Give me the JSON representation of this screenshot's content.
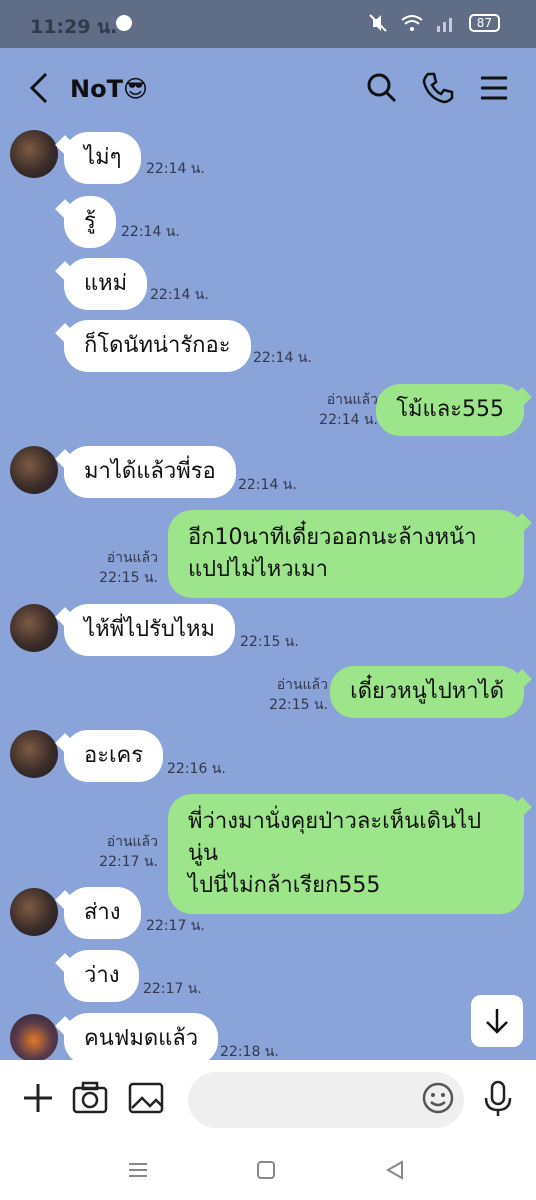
{
  "status": {
    "time": "11:29 น.",
    "battery": "87"
  },
  "header": {
    "title": "NoT😎"
  },
  "messages": [
    {
      "dir": "in",
      "text": "ไม่ๆ",
      "time": "22:14 น."
    },
    {
      "dir": "in",
      "text": "รู้",
      "time": "22:14 น."
    },
    {
      "dir": "in",
      "text": "แหม่",
      "time": "22:14 น."
    },
    {
      "dir": "in",
      "text": "ก็โดนัทน่ารักอะ",
      "time": "22:14 น."
    },
    {
      "dir": "out",
      "text": "โม้และ555",
      "read": "อ่านแล้ว",
      "time": "22:14 น."
    },
    {
      "dir": "in",
      "text": "มาได้แล้วพี่รอ",
      "time": "22:14 น."
    },
    {
      "dir": "out",
      "text": "อีก10นาทีเดี๋ยวออกนะล้างหน้าแปปไม่ไหวเมา",
      "line1": "อีก10นาทีเดี๋ยวออกนะล้างหน้า",
      "line2": "แปปไม่ไหวเมา",
      "read": "อ่านแล้ว",
      "time": "22:15 น."
    },
    {
      "dir": "in",
      "text": "ไห้พี่ไปรับไหม",
      "time": "22:15 น."
    },
    {
      "dir": "out",
      "text": "เดี๋ยวหนูไปหาได้",
      "read": "อ่านแล้ว",
      "time": "22:15 น."
    },
    {
      "dir": "in",
      "text": "อะเคร",
      "time": "22:16 น."
    },
    {
      "dir": "out",
      "text": "พี่ว่างมานั่งคุยป่าวละเห็นเดินไปนู่นไปนี่ไม่กล้าเรียก555",
      "line1": "พี่ว่างมานั่งคุยป่าวละเห็นเดินไปนู่น",
      "line2": "ไปนี่ไม่กล้าเรียก555",
      "read": "อ่านแล้ว",
      "time": "22:17 น."
    },
    {
      "dir": "in",
      "text": "ส่าง",
      "time": "22:17 น."
    },
    {
      "dir": "in",
      "text": "ว่าง",
      "time": "22:17 น."
    },
    {
      "dir": "in",
      "text": "คนฟมดแล้ว",
      "time": "22:18 น."
    }
  ],
  "icons": {
    "back": "chevron-left-icon",
    "search": "search-icon",
    "call": "phone-icon",
    "menu": "menu-icon",
    "add": "plus-icon",
    "camera": "camera-icon",
    "image": "image-icon",
    "emoji": "emoji-icon",
    "mic": "microphone-icon",
    "scroll": "arrow-down-icon"
  },
  "colors": {
    "background": "#8aa3d8",
    "incoming": "#ffffff",
    "outgoing": "#9ce58a"
  }
}
